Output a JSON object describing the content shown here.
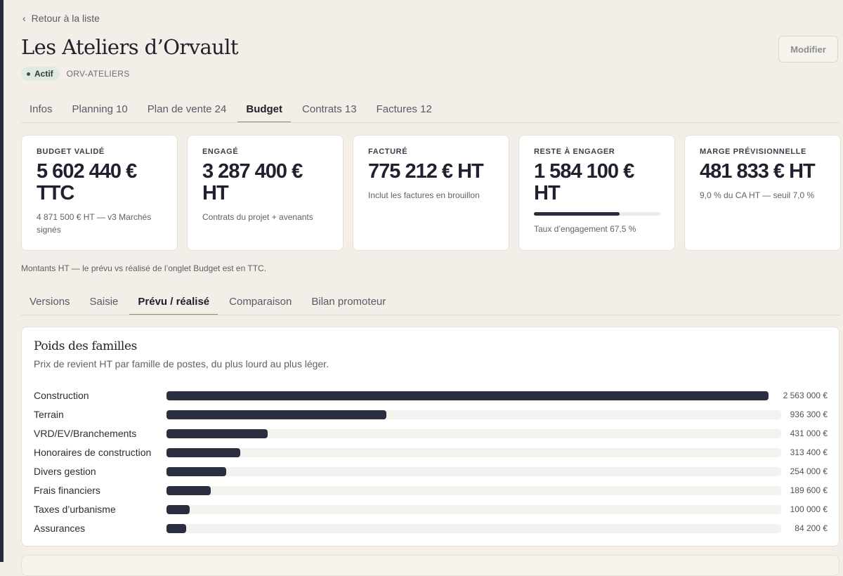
{
  "nav": {
    "back_label": "Retour à la liste",
    "back_icon": "chevron-left-icon"
  },
  "project": {
    "title": "Les Ateliers d’Orvault",
    "status": "Actif",
    "status_color": "#2e5a3c",
    "code": "ORV-ATELIERS"
  },
  "actions": {
    "edit_label": "Modifier"
  },
  "tabs": [
    {
      "label": "Infos",
      "active": false
    },
    {
      "label": "Planning 10",
      "active": false
    },
    {
      "label": "Plan de vente 24",
      "active": false
    },
    {
      "label": "Budget",
      "active": true
    },
    {
      "label": "Contrats 13",
      "active": false
    },
    {
      "label": "Factures 12",
      "active": false
    }
  ],
  "kpis": [
    {
      "label": "BUDGET VALIDÉ",
      "value": "5 602 440 € TTC",
      "sub": "4 871 500 € HT — v3 Marchés signés"
    },
    {
      "label": "ENGAGÉ",
      "value": "3 287 400 € HT",
      "sub": "Contrats du projet + avenants"
    },
    {
      "label": "FACTURÉ",
      "value": "775 212 € HT",
      "sub": "Inclut les factures en brouillon"
    },
    {
      "label": "RESTE À ENGAGER",
      "value": "1 584 100 € HT",
      "progress": 67.5,
      "sub": "Taux d’engagement 67,5 %"
    },
    {
      "label": "MARGE PRÉVISIONNELLE",
      "value": "481 833 € HT",
      "sub": "9,0 % du CA HT — seuil 7,0 %"
    }
  ],
  "note": "Montants HT — le prévu vs réalisé de l’onglet Budget est en TTC.",
  "subtabs": [
    {
      "label": "Versions",
      "active": false
    },
    {
      "label": "Saisie",
      "active": false
    },
    {
      "label": "Prévu / réalisé",
      "active": true
    },
    {
      "label": "Comparaison",
      "active": false
    },
    {
      "label": "Bilan promoteur",
      "active": false
    }
  ],
  "panel": {
    "title": "Poids des familles",
    "subtitle": "Prix de revient HT par famille de postes, du plus lourd au plus léger."
  },
  "chart_data": {
    "type": "bar",
    "orientation": "horizontal",
    "unit": "€",
    "max": 2563000,
    "categories": [
      "Construction",
      "Terrain",
      "VRD/EV/Branchements",
      "Honoraires de construction",
      "Divers gestion",
      "Frais financiers",
      "Taxes d’urbanisme",
      "Assurances"
    ],
    "values": [
      2563000,
      936300,
      431000,
      313400,
      254000,
      189600,
      100000,
      84200
    ],
    "labels": [
      "2 563 000 €",
      "936 300 €",
      "431 000 €",
      "313 400 €",
      "254 000 €",
      "189 600 €",
      "100 000 €",
      "84 200 €"
    ],
    "bar_color": "#2a2e3e",
    "track_color": "#f4f2ee"
  }
}
